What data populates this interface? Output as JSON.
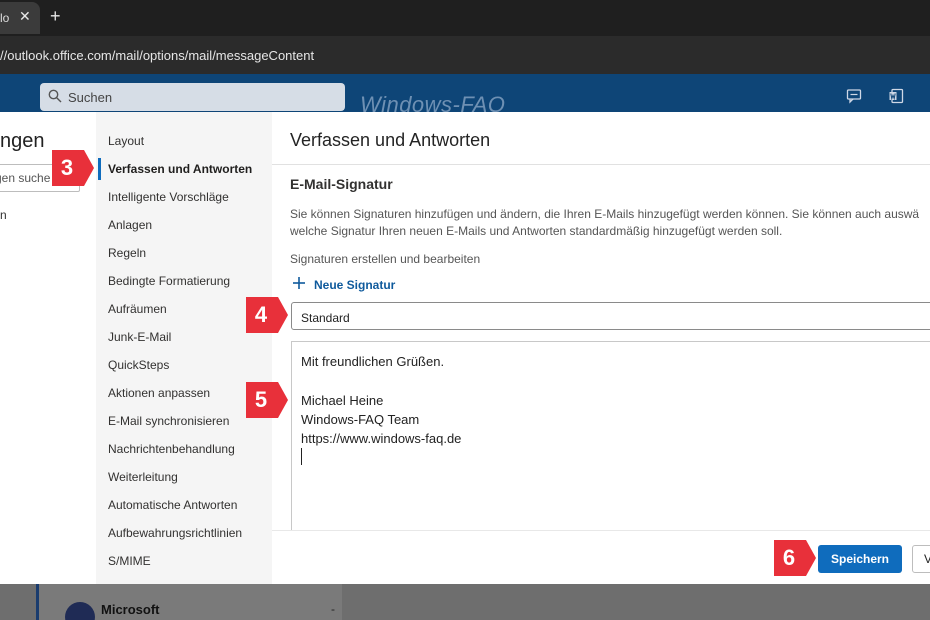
{
  "browser": {
    "tab_title": "lo",
    "close_glyph": "✕",
    "new_tab_glyph": "+",
    "url": "//outlook.office.com/mail/options/mail/messageContent"
  },
  "header": {
    "search_placeholder": "Suchen",
    "watermark": "Windows-FAQ",
    "icons": [
      "feedback-icon",
      "word-icon"
    ],
    "accent": "#0e4577"
  },
  "settings": {
    "title": "ngen",
    "search_placeholder": "gen suche",
    "left_fragment": "n"
  },
  "nav": {
    "items": [
      {
        "label": "Layout"
      },
      {
        "label": "Verfassen und Antworten"
      },
      {
        "label": "Intelligente Vorschläge"
      },
      {
        "label": "Anlagen"
      },
      {
        "label": "Regeln"
      },
      {
        "label": "Bedingte Formatierung"
      },
      {
        "label": "Aufräumen"
      },
      {
        "label": "Junk-E-Mail"
      },
      {
        "label": "QuickSteps"
      },
      {
        "label": "Aktionen anpassen"
      },
      {
        "label": "E-Mail synchronisieren"
      },
      {
        "label": "Nachrichtenbehandlung"
      },
      {
        "label": "Weiterleitung"
      },
      {
        "label": "Automatische Antworten"
      },
      {
        "label": "Aufbewahrungsrichtlinien"
      },
      {
        "label": "S/MIME"
      }
    ],
    "active_label": "Verfassen und Antworten"
  },
  "content": {
    "title": "Verfassen und Antworten",
    "section_title": "E-Mail-Signatur",
    "description": "Sie können Signaturen hinzufügen und ändern, die Ihren E-Mails hinzugefügt werden können. Sie können auch auswä welche Signatur Ihren neuen E-Mails und Antworten standardmäßig hinzugefügt werden soll.",
    "sub_label": "Signaturen erstellen und bearbeiten",
    "new_signature_label": "Neue Signatur",
    "signature_select_value": "Standard",
    "signature_lines": [
      "Mit freundlichen Grüßen.",
      "",
      "Michael Heine",
      "Windows-FAQ Team",
      "https://www.windows-faq.de"
    ],
    "save_label": "Speichern",
    "discard_label": "V",
    "save_color": "#0f6cbd"
  },
  "background_app": {
    "sender": "Microsoft",
    "dash": "-"
  },
  "steps": {
    "marker_color": "#e8303a",
    "s3": "3",
    "s4": "4",
    "s5": "5",
    "s6": "6"
  }
}
